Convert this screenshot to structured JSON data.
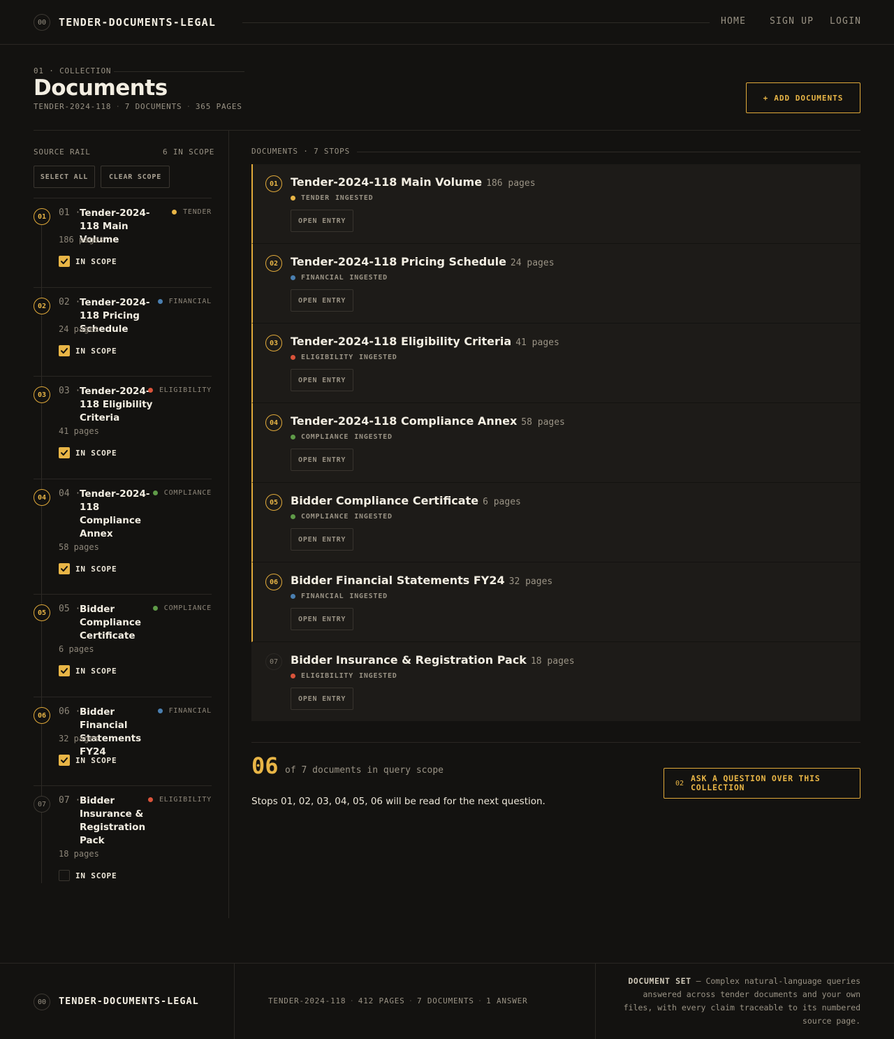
{
  "header": {
    "logo_num": "00",
    "brand": "TENDER-DOCUMENTS-LEGAL",
    "nav": [
      "HOME",
      "SIGN UP",
      "LOGIN"
    ]
  },
  "page": {
    "eyebrow": "01 · COLLECTION",
    "title": "Documents",
    "meta": [
      "TENDER-2024-118",
      "7 DOCUMENTS",
      "365 PAGES"
    ],
    "add_button": "ADD DOCUMENTS",
    "add_icon": "+"
  },
  "rail": {
    "label": "SOURCE RAIL",
    "scope_count": "6 IN SCOPE",
    "select_all": "SELECT ALL",
    "clear_scope": "CLEAR SCOPE",
    "scope_label": "IN SCOPE",
    "items": [
      {
        "num": "01",
        "idx": "01 ·",
        "title": "Tender-2024-118 Main Volume",
        "category": "TENDER",
        "color": "#e8b546",
        "pages": "186 pages",
        "in_scope": true
      },
      {
        "num": "02",
        "idx": "02 ·",
        "title": "Tender-2024-118 Pricing Schedule",
        "category": "FINANCIAL",
        "color": "#4a7fb0",
        "pages": "24 pages",
        "in_scope": true
      },
      {
        "num": "03",
        "idx": "03 ·",
        "title": "Tender-2024-118 Eligibility Criteria",
        "category": "ELIGIBILITY",
        "color": "#d9533a",
        "pages": "41 pages",
        "in_scope": true
      },
      {
        "num": "04",
        "idx": "04 ·",
        "title": "Tender-2024-118 Compliance Annex",
        "category": "COMPLIANCE",
        "color": "#5f9b48",
        "pages": "58 pages",
        "in_scope": true
      },
      {
        "num": "05",
        "idx": "05 ·",
        "title": "Bidder Compliance Certificate",
        "category": "COMPLIANCE",
        "color": "#5f9b48",
        "pages": "6 pages",
        "in_scope": true
      },
      {
        "num": "06",
        "idx": "06 ·",
        "title": "Bidder Financial Statements FY24",
        "category": "FINANCIAL",
        "color": "#4a7fb0",
        "pages": "32 pages",
        "in_scope": true
      },
      {
        "num": "07",
        "idx": "07 ·",
        "title": "Bidder Insurance & Registration Pack",
        "category": "ELIGIBILITY",
        "color": "#d9533a",
        "pages": "18 pages",
        "in_scope": false
      }
    ]
  },
  "main": {
    "section_label": "DOCUMENTS · 7 STOPS",
    "status": "INGESTED",
    "open_label": "OPEN ENTRY",
    "documents": [
      {
        "num": "01",
        "title": "Tender-2024-118 Main Volume",
        "pages": "186 pages",
        "category": "TENDER",
        "color": "#e8b546",
        "in_scope": true
      },
      {
        "num": "02",
        "title": "Tender-2024-118 Pricing Schedule",
        "pages": "24 pages",
        "category": "FINANCIAL",
        "color": "#4a7fb0",
        "in_scope": true
      },
      {
        "num": "03",
        "title": "Tender-2024-118 Eligibility Criteria",
        "pages": "41 pages",
        "category": "ELIGIBILITY",
        "color": "#d9533a",
        "in_scope": true
      },
      {
        "num": "04",
        "title": "Tender-2024-118 Compliance Annex",
        "pages": "58 pages",
        "category": "COMPLIANCE",
        "color": "#5f9b48",
        "in_scope": true
      },
      {
        "num": "05",
        "title": "Bidder Compliance Certificate",
        "pages": "6 pages",
        "category": "COMPLIANCE",
        "color": "#5f9b48",
        "in_scope": true
      },
      {
        "num": "06",
        "title": "Bidder Financial Statements FY24",
        "pages": "32 pages",
        "category": "FINANCIAL",
        "color": "#4a7fb0",
        "in_scope": true
      },
      {
        "num": "07",
        "title": "Bidder Insurance & Registration Pack",
        "pages": "18 pages",
        "category": "ELIGIBILITY",
        "color": "#d9533a",
        "in_scope": false
      }
    ]
  },
  "summary": {
    "count": "06",
    "count_text": "of 7 documents in query scope",
    "ask_key": "02",
    "ask_label": "ASK A QUESTION OVER THIS COLLECTION",
    "note": "Stops 01, 02, 03, 04, 05, 06 will be read for the next question."
  },
  "footer": {
    "logo_num": "00",
    "brand": "TENDER-DOCUMENTS-LEGAL",
    "meta": [
      "TENDER-2024-118",
      "412 PAGES",
      "7 DOCUMENTS",
      "1 ANSWER"
    ],
    "desc_title": "DOCUMENT SET",
    "desc_text": " — Complex natural-language queries answered across tender documents and your own files, with every claim traceable to its numbered source page."
  },
  "colors": {
    "accent": "#e8b546",
    "background": "#131210",
    "card": "#1d1b18"
  }
}
